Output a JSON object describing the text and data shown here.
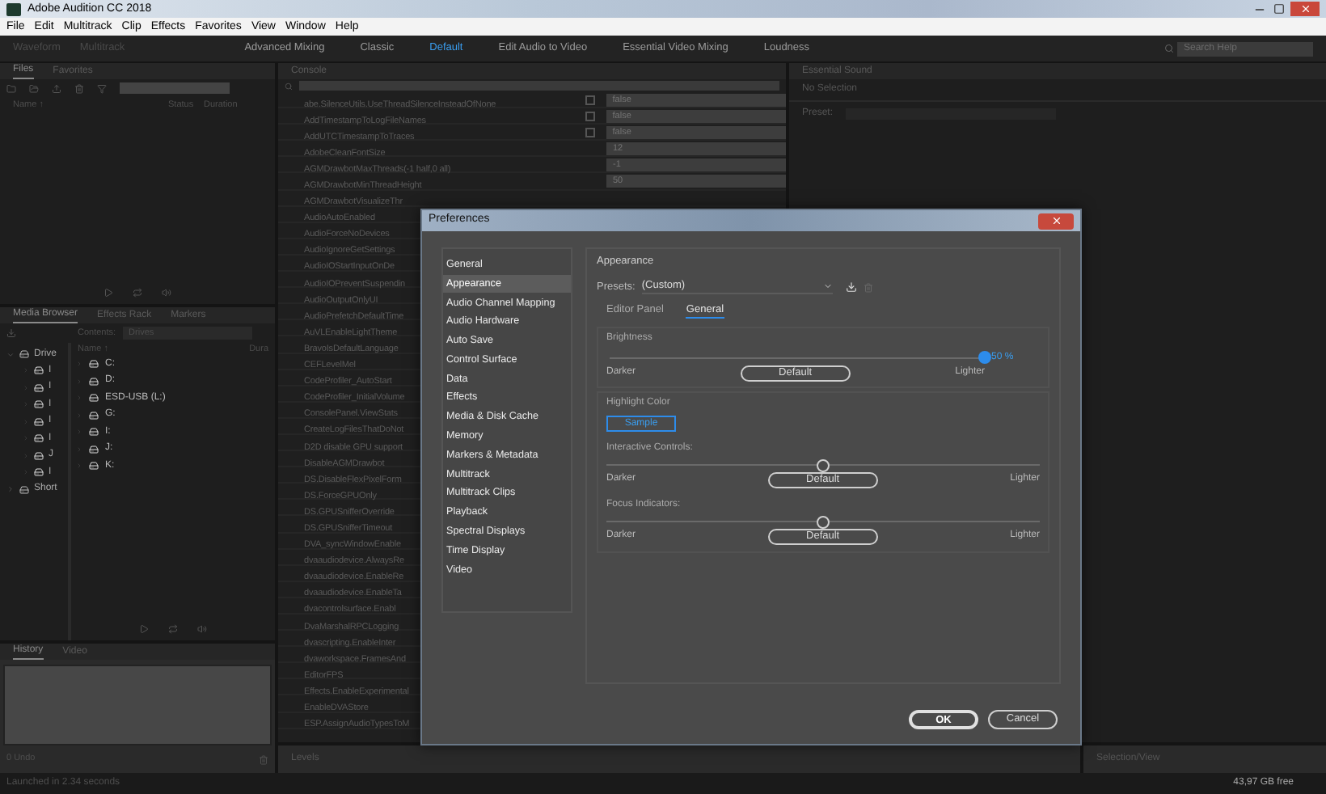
{
  "window": {
    "title": "Adobe Audition CC 2018"
  },
  "menu": [
    "File",
    "Edit",
    "Multitrack",
    "Clip",
    "Effects",
    "Favorites",
    "View",
    "Window",
    "Help"
  ],
  "toolbar": {
    "modes": [
      "Waveform",
      "Multitrack"
    ],
    "workspaces": [
      {
        "label": "Advanced Mixing",
        "selected": false
      },
      {
        "label": "Classic",
        "selected": false
      },
      {
        "label": "Default",
        "selected": true
      },
      {
        "label": "Edit Audio to Video",
        "selected": false
      },
      {
        "label": "Essential Video Mixing",
        "selected": false
      },
      {
        "label": "Loudness",
        "selected": false
      }
    ],
    "search": {
      "placeholder": "Search Help"
    }
  },
  "files_panel": {
    "tabs": [
      {
        "label": "Files",
        "selected": true
      },
      {
        "label": "Favorites",
        "selected": false
      }
    ],
    "columns": [
      "Name ↑",
      "Status",
      "Duration"
    ]
  },
  "media_browser": {
    "tabs": [
      {
        "label": "Media Browser",
        "selected": true
      },
      {
        "label": "Effects Rack",
        "selected": false
      },
      {
        "label": "Markers",
        "selected": false
      }
    ],
    "contents_label": "Contents:",
    "contents_value": "Drives",
    "tree": [
      {
        "label": "Drive",
        "expanded": true,
        "children": [
          {
            "label": "I"
          },
          {
            "label": "I"
          },
          {
            "label": "I"
          },
          {
            "label": "I"
          },
          {
            "label": "I"
          },
          {
            "label": "J"
          },
          {
            "label": "I"
          }
        ]
      },
      {
        "label": "Short",
        "expanded": false
      }
    ],
    "columns": [
      "Name ↑",
      "Dura"
    ],
    "items": [
      "C:",
      "D:",
      "ESD-USB (L:)",
      "G:",
      "I:",
      "J:",
      "K:"
    ]
  },
  "history": {
    "tabs": [
      {
        "label": "History",
        "selected": true
      },
      {
        "label": "Video",
        "selected": false
      }
    ],
    "status": "0 Undo"
  },
  "console": {
    "tab": "Console",
    "rows": [
      {
        "name": "abe.SilenceUtils.UseThreadSilenceInsteadOfNone",
        "kind": "bool",
        "checked": false,
        "value": "false"
      },
      {
        "name": "AddTimestampToLogFileNames",
        "kind": "bool",
        "checked": false,
        "value": "false"
      },
      {
        "name": "AddUTCTimestampToTraces",
        "kind": "bool",
        "checked": false,
        "value": "false"
      },
      {
        "name": "AdobeCleanFontSize",
        "kind": "text",
        "value": "12"
      },
      {
        "name": "AGMDrawbotMaxThreads(-1 half,0 all)",
        "kind": "text",
        "value": "-1"
      },
      {
        "name": "AGMDrawbotMinThreadHeight",
        "kind": "text",
        "value": "50"
      },
      {
        "name": "AGMDrawbotVisualizeThr",
        "kind": "name"
      },
      {
        "name": "AudioAutoEnabled",
        "kind": "name"
      },
      {
        "name": "AudioForceNoDevices",
        "kind": "name"
      },
      {
        "name": "AudioIgnoreGetSettings",
        "kind": "name"
      },
      {
        "name": "AudioIOStartInputOnDe",
        "kind": "name"
      },
      {
        "name": "AudioIOPreventSuspendin",
        "kind": "name"
      },
      {
        "name": "AudioOutputOnlyUI",
        "kind": "name"
      },
      {
        "name": "AudioPrefetchDefaultTime",
        "kind": "name"
      },
      {
        "name": "AuVLEnableLightTheme",
        "kind": "name"
      },
      {
        "name": "BravoIsDefaultLanguage",
        "kind": "name"
      },
      {
        "name": "CEFLevelMel",
        "kind": "name"
      },
      {
        "name": "CodeProfiler_AutoStart",
        "kind": "name"
      },
      {
        "name": "CodeProfiler_InitialVolume",
        "kind": "name"
      },
      {
        "name": "ConsolePanel.ViewStats",
        "kind": "name"
      },
      {
        "name": "CreateLogFilesThatDoNot",
        "kind": "name"
      },
      {
        "name": "D2D disable GPU support",
        "kind": "name"
      },
      {
        "name": "DisableAGMDrawbot",
        "kind": "name"
      },
      {
        "name": "DS.DisableFlexPixelForm",
        "kind": "name"
      },
      {
        "name": "DS.ForceGPUOnly",
        "kind": "name"
      },
      {
        "name": "DS.GPUSnifferOverride",
        "kind": "name"
      },
      {
        "name": "DS.GPUSnifferTimeout",
        "kind": "name"
      },
      {
        "name": "DVA_syncWindowEnable",
        "kind": "name"
      },
      {
        "name": "dvaaudiodevice.AlwaysRe",
        "kind": "name"
      },
      {
        "name": "dvaaudiodevice.EnableRe",
        "kind": "name"
      },
      {
        "name": "dvaaudiodevice.EnableTa",
        "kind": "name"
      },
      {
        "name": "dvacontrolsurface.Enabl",
        "kind": "name"
      },
      {
        "name": "DvaMarshalRPCLogging",
        "kind": "name"
      },
      {
        "name": "dvascripting.EnableInter",
        "kind": "name"
      },
      {
        "name": "dvaworkspace.FramesAnd",
        "kind": "name"
      },
      {
        "name": "EditorFPS",
        "kind": "name"
      },
      {
        "name": "Effects.EnableExperimental",
        "kind": "name"
      },
      {
        "name": "EnableDVAStore",
        "kind": "name"
      },
      {
        "name": "ESP.AssignAudioTypesToM",
        "kind": "name"
      }
    ]
  },
  "essential_sound": {
    "tab": "Essential Sound",
    "status": "No Selection",
    "preset_label": "Preset:"
  },
  "levels": {
    "tab": "Levels"
  },
  "selection_view": {
    "tab": "Selection/View"
  },
  "status_bar": {
    "left": "Launched in 2.34 seconds",
    "right": "43,97 GB free"
  },
  "dialog": {
    "title": "Preferences",
    "categories": [
      {
        "label": "General",
        "selected": false
      },
      {
        "label": "Appearance",
        "selected": true
      },
      {
        "label": "Audio Channel Mapping",
        "selected": false
      },
      {
        "label": "Audio Hardware",
        "selected": false
      },
      {
        "label": "Auto Save",
        "selected": false
      },
      {
        "label": "Control Surface",
        "selected": false
      },
      {
        "label": "Data",
        "selected": false
      },
      {
        "label": "Effects",
        "selected": false
      },
      {
        "label": "Media & Disk Cache",
        "selected": false
      },
      {
        "label": "Memory",
        "selected": false
      },
      {
        "label": "Markers & Metadata",
        "selected": false
      },
      {
        "label": "Multitrack",
        "selected": false
      },
      {
        "label": "Multitrack Clips",
        "selected": false
      },
      {
        "label": "Playback",
        "selected": false
      },
      {
        "label": "Spectral Displays",
        "selected": false
      },
      {
        "label": "Time Display",
        "selected": false
      },
      {
        "label": "Video",
        "selected": false
      }
    ],
    "heading": "Appearance",
    "presets": {
      "label": "Presets:",
      "value": "(Custom)"
    },
    "tabs": [
      {
        "label": "Editor Panel",
        "selected": false
      },
      {
        "label": "General",
        "selected": true
      }
    ],
    "brightness": {
      "title": "Brightness",
      "level": 1.0,
      "reading": "50 %",
      "low": "Darker",
      "button": "Default",
      "high": "Lighter"
    },
    "highlight": {
      "title": "Highlight Color",
      "button": "Sample"
    },
    "sliders": [
      {
        "title": "Interactive Controls:",
        "level": 0.5,
        "low": "Darker",
        "button": "Default",
        "high": "Lighter"
      },
      {
        "title": "Focus Indicators:",
        "level": 0.5,
        "low": "Darker",
        "button": "Default",
        "high": "Lighter"
      }
    ],
    "buttons": [
      "OK",
      "Cancel"
    ]
  }
}
